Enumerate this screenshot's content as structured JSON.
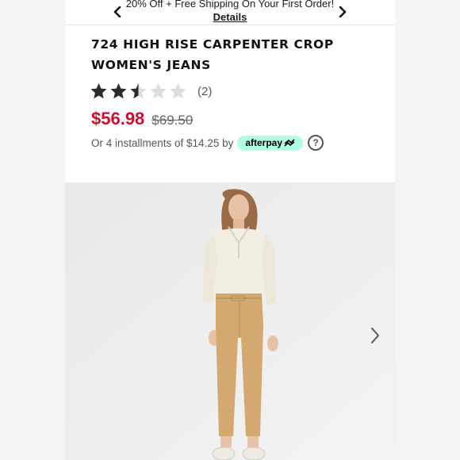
{
  "promo": {
    "text": "20% Off + Free Shipping On Your First Order!",
    "link_label": "Details"
  },
  "product": {
    "title_line1": "724 HIGH RISE CARPENTER CROP",
    "title_line2": "WOMEN'S JEANS",
    "rating": 2.5,
    "rating_max": 5,
    "review_count": "(2)",
    "sale_price": "$56.98",
    "original_price": "$69.50",
    "installments_text": "Or 4 installments of $14.25 by",
    "afterpay_label": "afterpay",
    "help_label": "?"
  },
  "colors": {
    "sale_price": "#c8102e",
    "afterpay_badge": "#b2fce4",
    "star_filled": "#2b2b2b",
    "star_empty": "#dddddd"
  },
  "icons": {
    "promo_prev": "chevron-left-icon",
    "promo_next": "chevron-right-icon",
    "image_next": "chevron-right-icon",
    "star": "star-icon",
    "help": "question-circle-icon"
  }
}
